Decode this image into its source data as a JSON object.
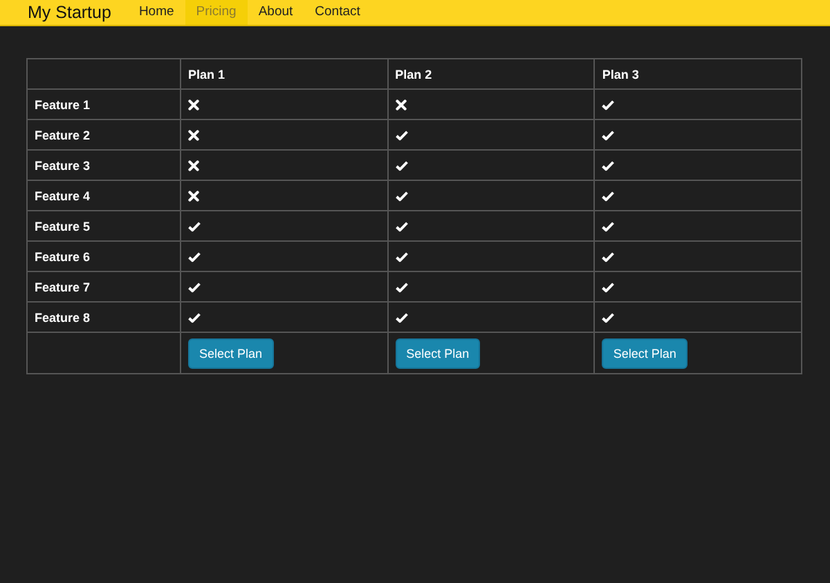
{
  "navbar": {
    "brand": "My Startup",
    "items": [
      {
        "label": "Home",
        "selected": false
      },
      {
        "label": "Pricing",
        "selected": true
      },
      {
        "label": "About",
        "selected": false
      },
      {
        "label": "Contact",
        "selected": false
      }
    ]
  },
  "table": {
    "columns": [
      "Plan 1",
      "Plan 2",
      "Plan 3"
    ],
    "rows": [
      {
        "feature": "Feature 1",
        "included": [
          false,
          false,
          true
        ]
      },
      {
        "feature": "Feature 2",
        "included": [
          false,
          true,
          true
        ]
      },
      {
        "feature": "Feature 3",
        "included": [
          false,
          true,
          true
        ]
      },
      {
        "feature": "Feature 4",
        "included": [
          false,
          true,
          true
        ]
      },
      {
        "feature": "Feature 5",
        "included": [
          true,
          true,
          true
        ]
      },
      {
        "feature": "Feature 6",
        "included": [
          true,
          true,
          true
        ]
      },
      {
        "feature": "Feature 7",
        "included": [
          true,
          true,
          true
        ]
      },
      {
        "feature": "Feature 8",
        "included": [
          true,
          true,
          true
        ]
      }
    ],
    "buttons": [
      "Select Plan",
      "Select Plan",
      "Select Plan"
    ]
  }
}
